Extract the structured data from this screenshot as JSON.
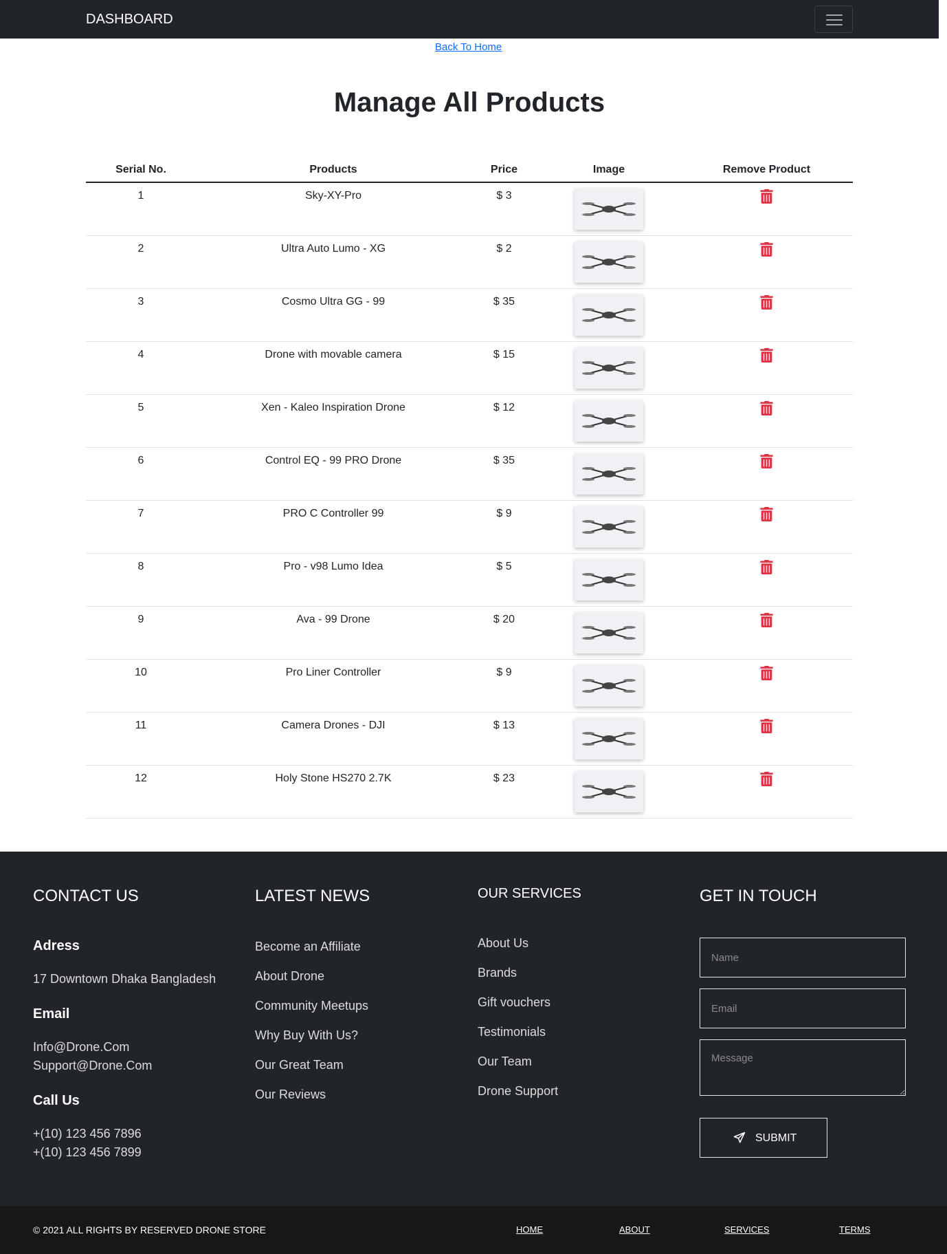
{
  "navbar": {
    "brand": "DASHBOARD"
  },
  "back_link": "Back To Home",
  "title": "Manage All Products",
  "table": {
    "headers": [
      "Serial No.",
      "Products",
      "Price",
      "Image",
      "Remove Product"
    ],
    "rows": [
      {
        "serial": "1",
        "product": "Sky-XY-Pro",
        "price": "$ 3"
      },
      {
        "serial": "2",
        "product": "Ultra Auto Lumo - XG",
        "price": "$ 2"
      },
      {
        "serial": "3",
        "product": "Cosmo Ultra GG - 99",
        "price": "$ 35"
      },
      {
        "serial": "4",
        "product": "Drone with movable camera",
        "price": "$ 15"
      },
      {
        "serial": "5",
        "product": "Xen - Kaleo Inspiration Drone",
        "price": "$ 12"
      },
      {
        "serial": "6",
        "product": "Control EQ - 99 PRO Drone",
        "price": "$ 35"
      },
      {
        "serial": "7",
        "product": "PRO C Controller 99",
        "price": "$ 9"
      },
      {
        "serial": "8",
        "product": "Pro - v98 Lumo Idea",
        "price": "$ 5"
      },
      {
        "serial": "9",
        "product": "Ava - 99 Drone",
        "price": "$ 20"
      },
      {
        "serial": "10",
        "product": "Pro Liner Controller",
        "price": "$ 9"
      },
      {
        "serial": "11",
        "product": "Camera Drones - DJI",
        "price": "$ 13"
      },
      {
        "serial": "12",
        "product": "Holy Stone HS270 2.7K",
        "price": "$ 23"
      }
    ]
  },
  "footer": {
    "contact": {
      "heading": "CONTACT US",
      "address_label": "Adress",
      "address": "17 Downtown Dhaka Bangladesh",
      "email_label": "Email",
      "emails": [
        "Info@Drone.Com",
        "Support@Drone.Com"
      ],
      "call_label": "Call Us",
      "phones": [
        "+(10) 123 456 7896",
        "+(10) 123 456 7899"
      ]
    },
    "news": {
      "heading": "LATEST NEWS",
      "items": [
        "Become an Affiliate",
        "About Drone",
        "Community Meetups",
        "Why Buy With Us?",
        "Our Great Team",
        "Our Reviews"
      ]
    },
    "services": {
      "heading": "OUR SERVICES",
      "items": [
        "About Us",
        "Brands",
        "Gift vouchers",
        "Testimonials",
        "Our Team",
        "Drone Support"
      ]
    },
    "touch": {
      "heading": "GET IN TOUCH",
      "name_placeholder": "Name",
      "email_placeholder": "Email",
      "message_placeholder": "Message",
      "submit_label": "SUBMIT"
    }
  },
  "bottom": {
    "copyright": "© 2021 ALL RIGHTS BY RESERVED DRONE STORE",
    "links": [
      "HOME",
      "ABOUT",
      "SERVICES",
      "TERMS"
    ]
  },
  "colors": {
    "navbar": "#212529",
    "footer": "#212529",
    "bottom_bar": "#161719",
    "link": "#0d6efd",
    "danger": "#dc3545"
  },
  "icons": {
    "remove": "trash-icon",
    "submit": "paper-plane-icon",
    "menu": "hamburger-icon"
  }
}
